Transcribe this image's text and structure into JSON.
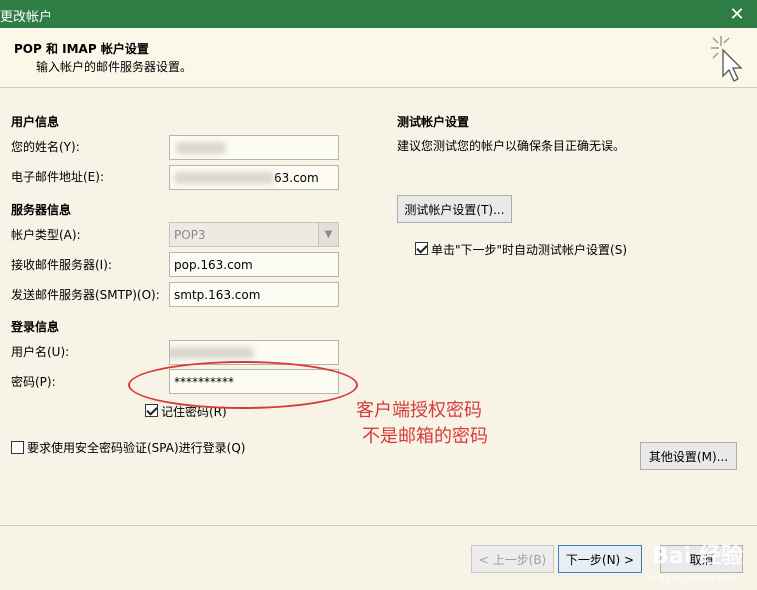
{
  "window": {
    "title": "更改帐户",
    "close_glyph": "✕"
  },
  "header": {
    "title": "POP 和 IMAP 帐户设置",
    "subtitle": "输入帐户的邮件服务器设置。",
    "icon": "pointer-sparkle-icon"
  },
  "user_info": {
    "section": "用户信息",
    "name_label": "您的姓名(Y):",
    "email_label": "电子邮件地址(E):",
    "email_visible_suffix": "63.com"
  },
  "server_info": {
    "section": "服务器信息",
    "account_type_label": "帐户类型(A):",
    "account_type_value": "POP3",
    "incoming_label": "接收邮件服务器(I):",
    "incoming_value": "pop.163.com",
    "outgoing_label": "发送邮件服务器(SMTP)(O):",
    "outgoing_value": "smtp.163.com"
  },
  "login_info": {
    "section": "登录信息",
    "username_label": "用户名(U):",
    "password_label": "密码(P):",
    "password_value": "**********",
    "remember_label": "记住密码(R)",
    "remember_checked": true,
    "spa_label": "要求使用安全密码验证(SPA)进行登录(Q)",
    "spa_checked": false
  },
  "test_settings": {
    "section": "测试帐户设置",
    "description": "建议您测试您的帐户以确保条目正确无误。",
    "test_button": "测试帐户设置(T)...",
    "auto_test_label": "单击\"下一步\"时自动测试帐户设置(S)",
    "auto_test_checked": true
  },
  "more_settings_button": "其他设置(M)...",
  "annotation": {
    "line1": "客户端授权密码",
    "line2": "不是邮箱的密码",
    "color": "#d93a3a"
  },
  "footer": {
    "back_button": "< 上一步(B)",
    "next_button": "下一步(N) >",
    "cancel_button": "取消"
  },
  "watermark": {
    "text": "Bai 经验",
    "sub": "jingyan.baidu.com"
  }
}
